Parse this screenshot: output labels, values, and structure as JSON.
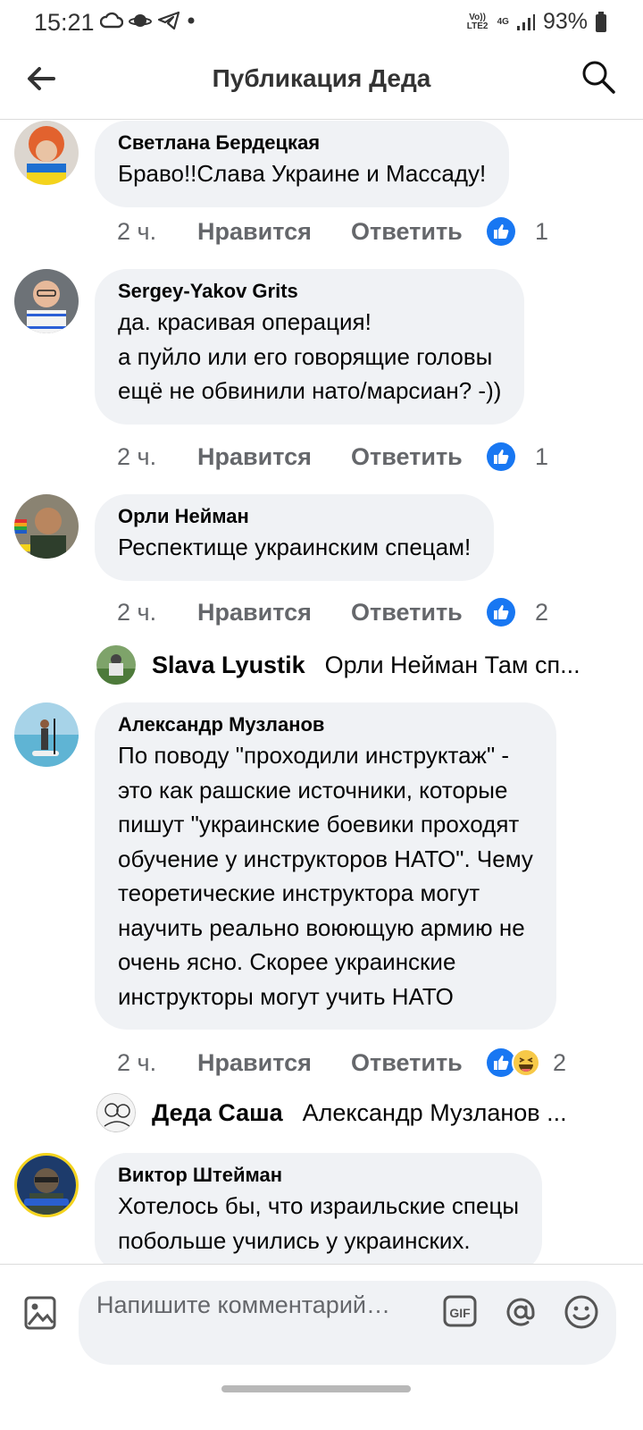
{
  "status": {
    "time": "15:21",
    "volte": "Vo)) LTE2",
    "net": "4G",
    "battery": "93%"
  },
  "header": {
    "title": "Публикация Деда"
  },
  "comments": [
    {
      "author": "Светлана Бердецкая",
      "text": "Браво!!Слава Украине и Массаду!",
      "time": "2 ч.",
      "like_label": "Нравится",
      "reply_label": "Ответить",
      "reaction_count": "1"
    },
    {
      "author": "Sergey-Yakov Grits",
      "text": "да. красивая операция!\nа пуйло или его говорящие головы\nещё не обвинили нато/марсиан? -))",
      "time": "2 ч.",
      "like_label": "Нравится",
      "reply_label": "Ответить",
      "reaction_count": "1"
    },
    {
      "author": "Орли Нейман",
      "text": "Респектище украинским спецам!",
      "time": "2 ч.",
      "like_label": "Нравится",
      "reply_label": "Ответить",
      "reaction_count": "2",
      "reply_preview": {
        "author": "Slava Lyustik",
        "text": "Орли Нейман Там сп..."
      }
    },
    {
      "author": "Александр Музланов",
      "text": "По поводу \"проходили инструктаж\" -\nэто как рашские источники, которые\nпишут \"украинские боевики проходят\nобучение у инструкторов НАТО\". Чему\nтеоретические инструктора могут\nнаучить реально воюющую армию не\nочень ясно. Скорее украинские\nинструкторы могут учить НАТО",
      "time": "2 ч.",
      "like_label": "Нравится",
      "reply_label": "Ответить",
      "reaction_count": "2",
      "reply_preview": {
        "author": "Деда Саша",
        "text": "Александр Музланов ..."
      }
    },
    {
      "author": "Виктор Штейман",
      "text": "Хотелось бы, что израильские спецы\nпобольше учились у украинских."
    }
  ],
  "composer": {
    "placeholder": "Напишите комментарий…",
    "gif_label": "GIF"
  },
  "colors": {
    "like_blue": "#1877f2",
    "bubble_bg": "#f0f2f5",
    "secondary_text": "#65676b"
  }
}
